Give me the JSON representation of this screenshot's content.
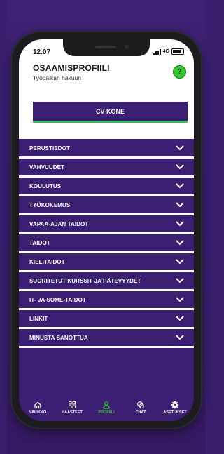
{
  "status": {
    "time": "12.07",
    "network": "4G"
  },
  "header": {
    "title": "OSAAMISPROFIILI",
    "subtitle": "Työpaikan hakuun",
    "help_label": "?"
  },
  "cv_button": {
    "label": "CV-KONE"
  },
  "sections": [
    {
      "label": "PERUSTIEDOT"
    },
    {
      "label": "VAHVUUDET"
    },
    {
      "label": "KOULUTUS"
    },
    {
      "label": "TYÖKOKEMUS"
    },
    {
      "label": "VAPAA-AJAN TAIDOT"
    },
    {
      "label": "TAIDOT"
    },
    {
      "label": "KIELITAIDOT"
    },
    {
      "label": "SUORITETUT KURSSIT JA PÄTEVYYDET"
    },
    {
      "label": "IT- JA SOME-TAIDOT"
    },
    {
      "label": "LINKIT"
    },
    {
      "label": "MINUSTA SANOTTUA"
    }
  ],
  "tabs": [
    {
      "label": "VALIKKO",
      "icon": "home-icon",
      "active": false
    },
    {
      "label": "HAASTEET",
      "icon": "grid-icon",
      "active": false
    },
    {
      "label": "PROFIILI",
      "icon": "user-icon",
      "active": true
    },
    {
      "label": "CHAT",
      "icon": "chat-icon",
      "active": false
    },
    {
      "label": "ASETUKSET",
      "icon": "gear-icon",
      "active": false
    }
  ],
  "colors": {
    "brand": "#3c1f72",
    "accent": "#35c636",
    "background": "#3a1f6e"
  }
}
